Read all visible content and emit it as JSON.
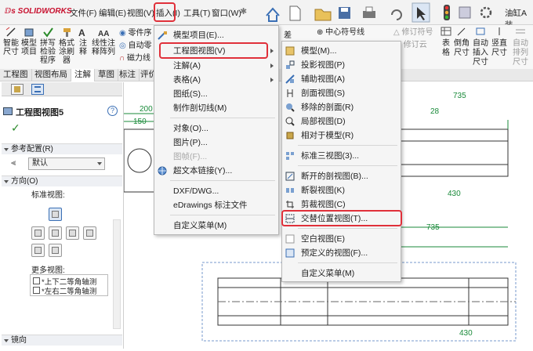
{
  "menubar": {
    "logo": "SOLIDWORKS",
    "items": [
      "文件(F)",
      "编辑(E)",
      "视图(V)",
      "插入(I)",
      "工具(T)",
      "窗口(W)"
    ],
    "doc_title": "油缸A装"
  },
  "ribbon": {
    "left": [
      "智能\n尺寸",
      "模型\n项目",
      "拼写\n检验\n程序",
      "格式\n涂刷\n器",
      "注\n释",
      "线性注\n释阵列"
    ],
    "partial": [
      "零件序",
      "自动零",
      "磁力线"
    ],
    "mid": [
      "差",
      "中心符号线",
      "修订符号",
      "修订云"
    ],
    "right": [
      "表\n格",
      "倒角\n尺寸",
      "自动\n插入\n尺寸",
      "竖直\n尺寸",
      "自动\n排列\n尺寸"
    ]
  },
  "tabs": [
    "工程图",
    "视图布局",
    "注解",
    "草图",
    "标注",
    "评价"
  ],
  "panel": {
    "title": "工程图视图5",
    "ref_config_label": "参考配置(R)",
    "ref_config_value": "默认",
    "orientation_label": "方向(O)",
    "standard_views_label": "标准视图:",
    "more_views_label": "更多视图:",
    "more_views": [
      "*上下二等角轴测",
      "*左右二等角轴测"
    ],
    "mirror_label": "镜向"
  },
  "insert_menu": {
    "items": [
      {
        "label": "模型项目(E)...",
        "icon": "model-items-icon"
      },
      {
        "label": "工程图视图(V)",
        "sub": true
      },
      {
        "label": "注解(A)",
        "sub": true
      },
      {
        "label": "表格(A)",
        "sub": true
      },
      {
        "label": "图纸(S)..."
      },
      {
        "label": "制作剖切线(M)"
      },
      {
        "label": "对象(O)..."
      },
      {
        "label": "图片(P)..."
      },
      {
        "label": "图帧(F)...",
        "disabled": true
      },
      {
        "label": "超文本链接(Y)...",
        "icon": "globe-icon"
      },
      {
        "label": "DXF/DWG..."
      },
      {
        "label": "eDrawings 标注文件"
      },
      {
        "label": "自定义菜单(M)"
      }
    ]
  },
  "view_submenu": {
    "items": [
      {
        "label": "模型(M)...",
        "icon": "model-view-icon"
      },
      {
        "label": "投影视图(P)",
        "icon": "projected-view-icon"
      },
      {
        "label": "辅助视图(A)",
        "icon": "auxiliary-view-icon"
      },
      {
        "label": "剖面视图(S)",
        "icon": "section-view-icon"
      },
      {
        "label": "移除的剖面(R)",
        "icon": "removed-section-icon"
      },
      {
        "label": "局部视图(D)",
        "icon": "detail-view-icon"
      },
      {
        "label": "相对于模型(R)",
        "icon": "relative-view-icon"
      },
      {
        "label": "标准三视图(3)...",
        "icon": "standard-3view-icon"
      },
      {
        "label": "断开的剖视图(B)...",
        "icon": "broken-out-section-icon"
      },
      {
        "label": "断裂视图(K)",
        "icon": "break-view-icon"
      },
      {
        "label": "剪裁视图(C)",
        "icon": "crop-view-icon"
      },
      {
        "label": "交替位置视图(T)...",
        "icon": "alternate-position-icon"
      },
      {
        "label": "空白视图(E)",
        "icon": "empty-view-icon"
      },
      {
        "label": "预定义的视图(F)...",
        "icon": "predefined-view-icon"
      },
      {
        "label": "自定义菜单(M)"
      }
    ]
  },
  "drawing": {
    "dims": [
      "200",
      "150",
      "735",
      "28",
      "430",
      "735",
      "430"
    ]
  },
  "colors": {
    "highlight": "#e0303a",
    "dim": "#1a8a3a",
    "drawing_line": "#333333"
  }
}
